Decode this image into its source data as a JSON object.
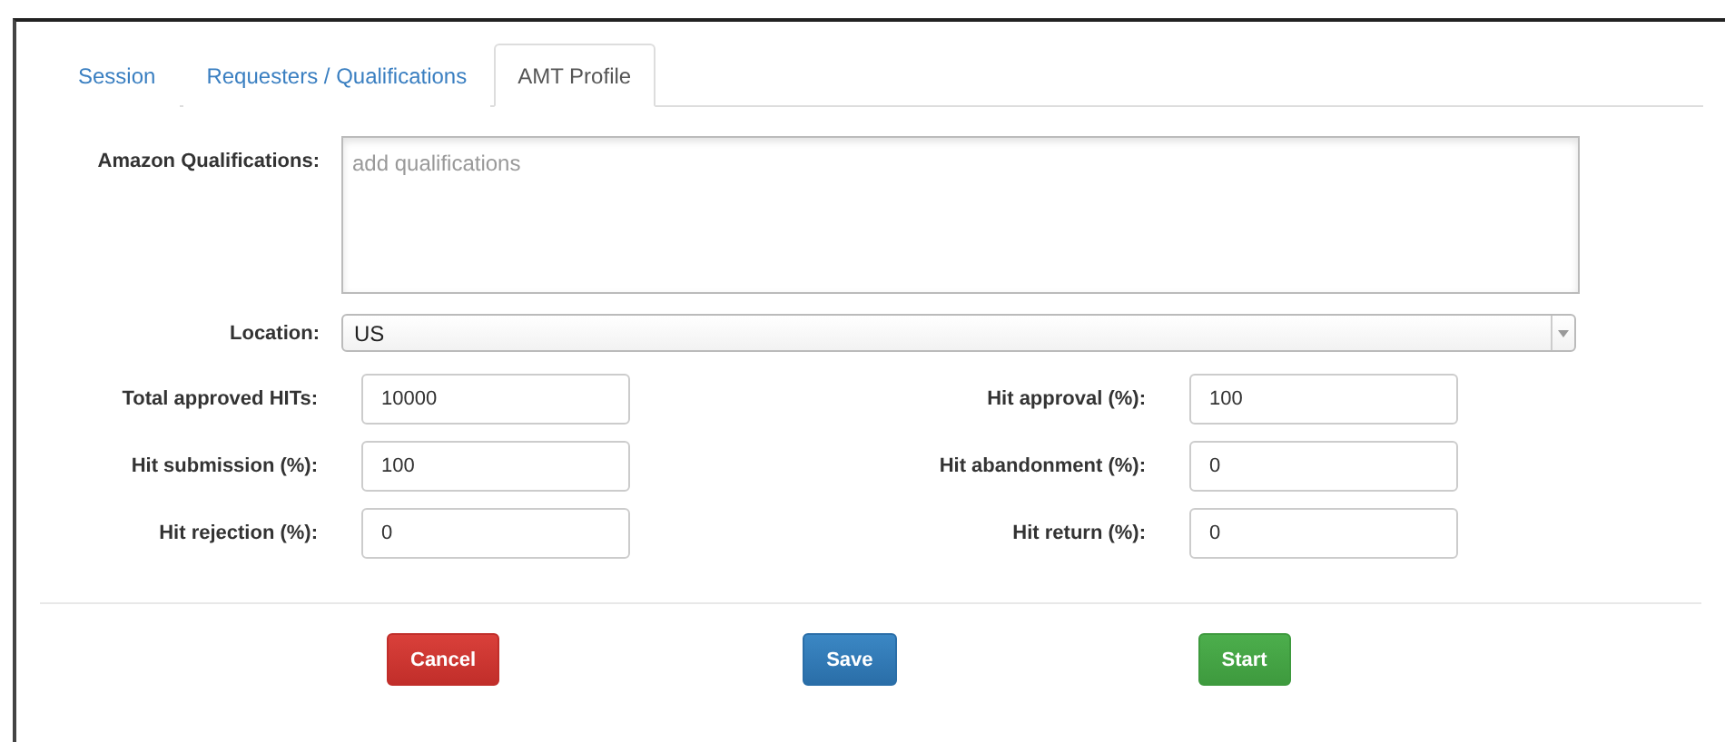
{
  "tabs": [
    {
      "label": "Session",
      "selected": false
    },
    {
      "label": "Requesters / Qualifications",
      "selected": false
    },
    {
      "label": "AMT Profile",
      "selected": true
    }
  ],
  "qualifications": {
    "label": "Amazon Qualifications:",
    "placeholder": "add qualifications"
  },
  "location": {
    "label": "Location:",
    "value": "US"
  },
  "fields": [
    {
      "label": "Total approved HITs:",
      "value": "10000"
    },
    {
      "label": "Hit approval (%):",
      "value": "100"
    },
    {
      "label": "Hit submission (%):",
      "value": "100"
    },
    {
      "label": "Hit abandonment (%):",
      "value": "0"
    },
    {
      "label": "Hit rejection (%):",
      "value": "0"
    },
    {
      "label": "Hit return (%):",
      "value": "0"
    }
  ],
  "buttons": [
    {
      "label": "Cancel",
      "kind": "cancel"
    },
    {
      "label": "Save",
      "kind": "save"
    },
    {
      "label": "Start",
      "kind": "start"
    }
  ]
}
